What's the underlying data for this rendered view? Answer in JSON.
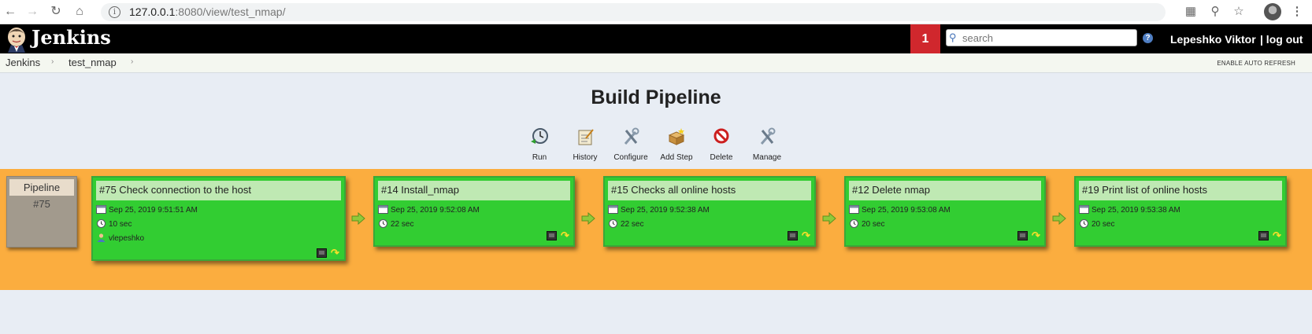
{
  "browser": {
    "url_host": "127.0.0.1",
    "url_rest": ":8080/view/test_nmap/"
  },
  "header": {
    "logo": "Jenkins",
    "notification_count": "1",
    "search_placeholder": "search",
    "help": "?",
    "user": "Lepeshko Viktor",
    "logout": "| log out"
  },
  "breadcrumbs": [
    "Jenkins",
    "test_nmap"
  ],
  "auto_refresh": "ENABLE AUTO REFRESH",
  "title": "Build Pipeline",
  "toolbar": [
    "Run",
    "History",
    "Configure",
    "Add Step",
    "Delete",
    "Manage"
  ],
  "pipeline": {
    "label": "Pipeline",
    "number": "#75"
  },
  "builds": [
    {
      "title": "#75 Check connection to the host",
      "date": "Sep 25, 2019 9:51:51 AM",
      "duration": "10 sec",
      "user": "vlepeshko"
    },
    {
      "title": "#14 Install_nmap",
      "date": "Sep 25, 2019 9:52:08 AM",
      "duration": "22 sec"
    },
    {
      "title": "#15 Checks all online hosts",
      "date": "Sep 25, 2019 9:52:38 AM",
      "duration": "22 sec"
    },
    {
      "title": "#12 Delete nmap",
      "date": "Sep 25, 2019 9:53:08 AM",
      "duration": "20 sec"
    },
    {
      "title": "#19 Print list of online hosts",
      "date": "Sep 25, 2019 9:53:38 AM",
      "duration": "20 sec"
    }
  ],
  "colors": {
    "band": "#fbad3f",
    "success": "#32cd32",
    "header": "#000000",
    "notification": "#d0272d"
  }
}
